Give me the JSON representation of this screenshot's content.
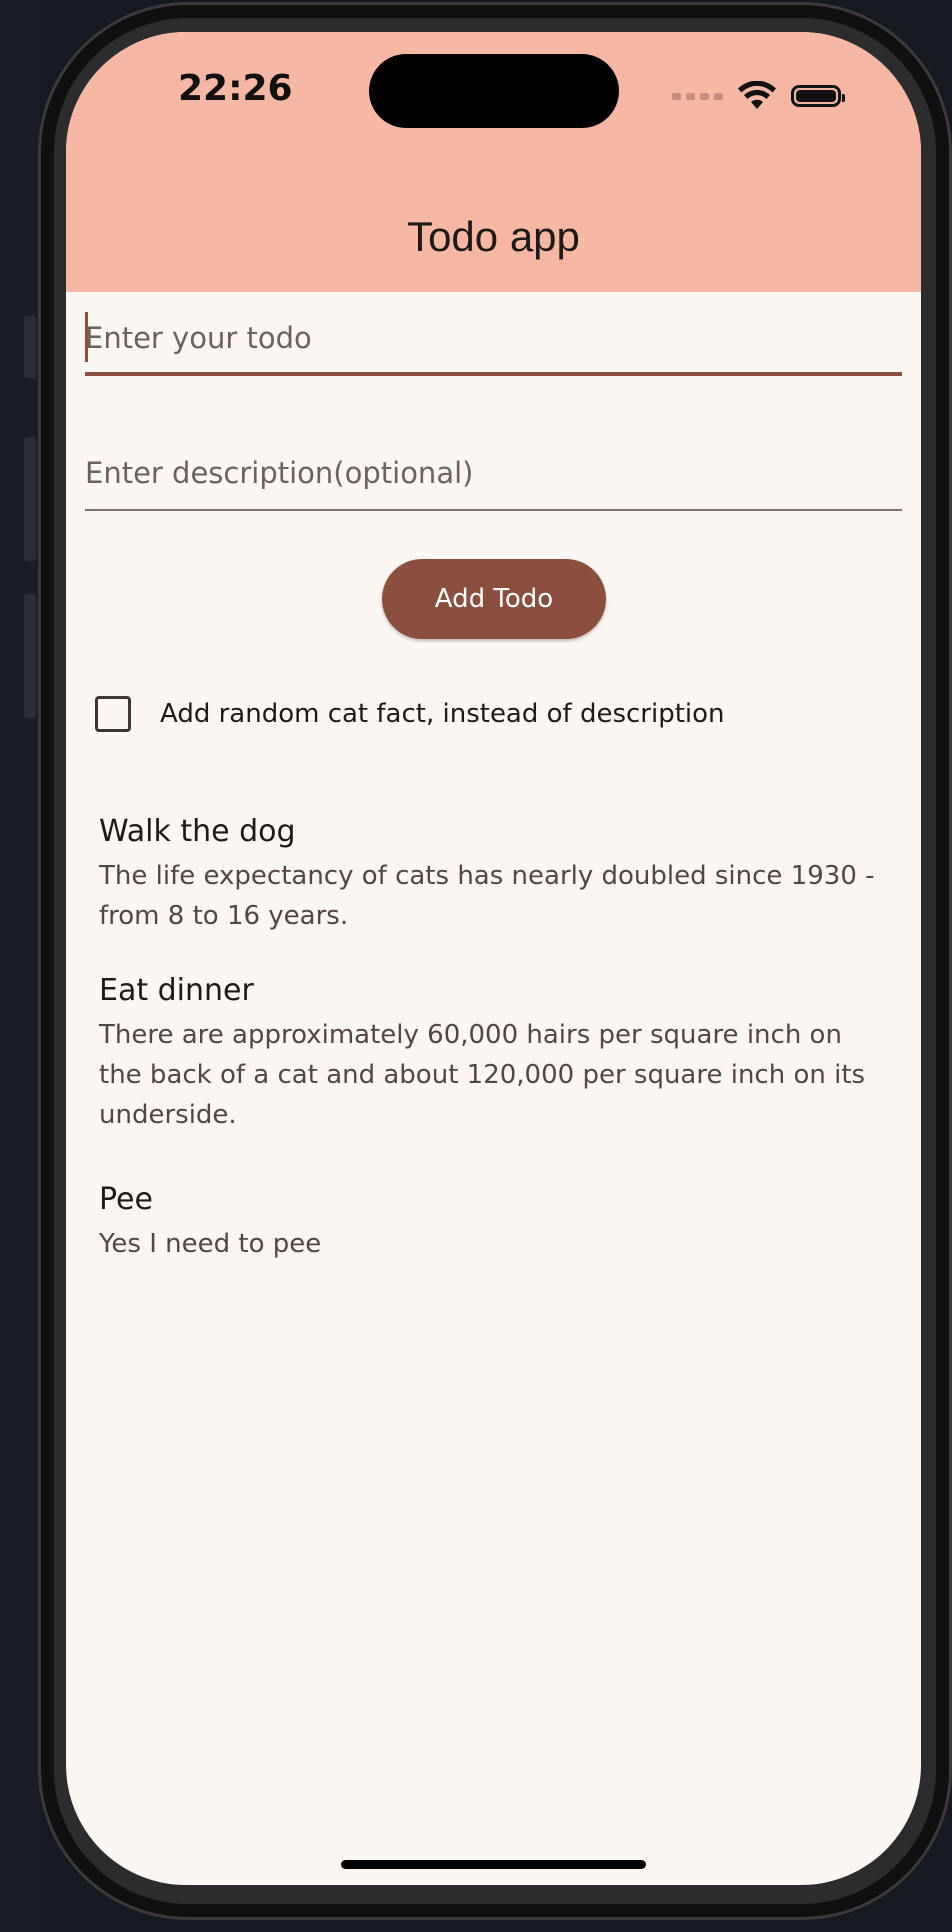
{
  "status_bar": {
    "time": "22:26",
    "icons": [
      "signal-icon",
      "wifi-icon",
      "battery-icon"
    ]
  },
  "app_bar": {
    "title": "Todo app"
  },
  "form": {
    "todo_placeholder": "Enter your todo",
    "todo_value": "",
    "description_placeholder": "Enter description(optional)",
    "description_value": "",
    "add_button_label": "Add Todo",
    "cat_fact_label": "Add random cat fact, instead of description",
    "cat_fact_checked": false
  },
  "todos": [
    {
      "title": "Walk the dog",
      "description": "The life expectancy of cats has nearly doubled since 1930 - from 8 to 16 years."
    },
    {
      "title": "Eat dinner",
      "description": "There are approximately 60,000 hairs per square inch on the back of a cat and about 120,000 per square inch on its underside."
    },
    {
      "title": "Pee",
      "description": "Yes I need to pee"
    }
  ],
  "colors": {
    "app_bar": "#f6b8a5",
    "background": "#fdf7f4",
    "primary": "#8a4f3f"
  }
}
